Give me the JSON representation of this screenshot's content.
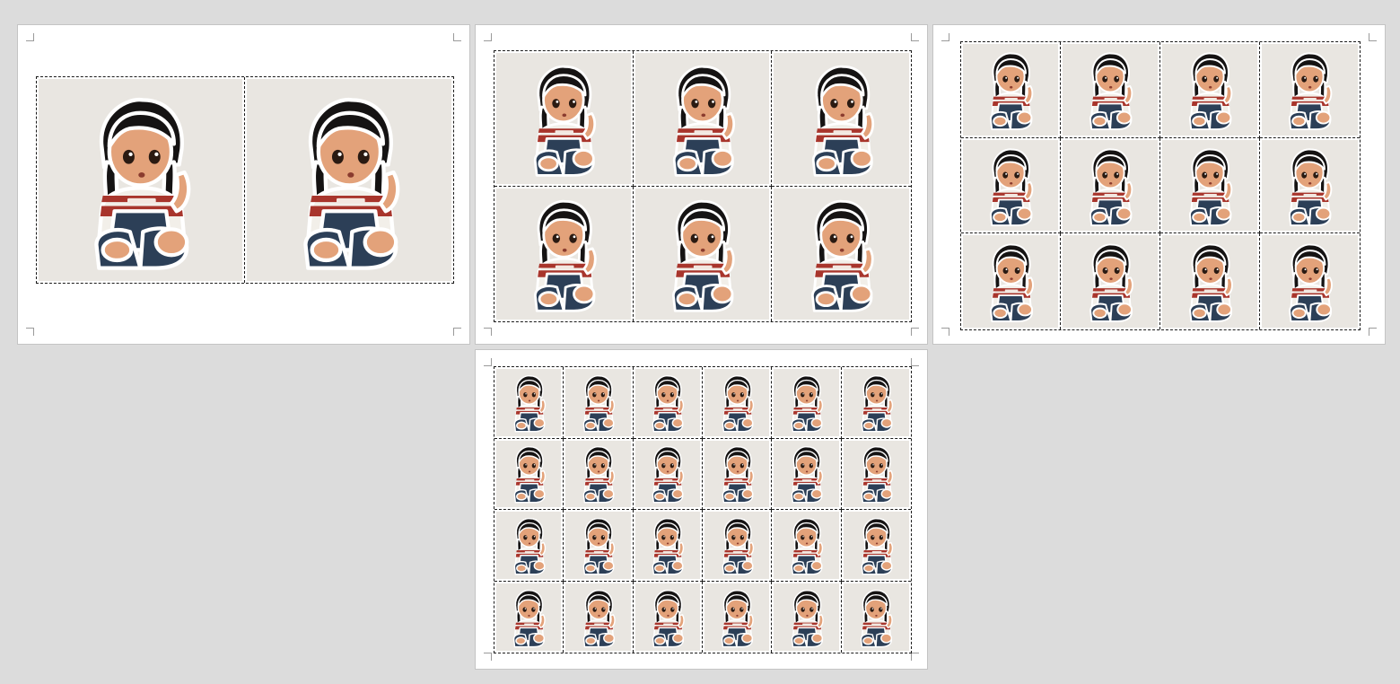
{
  "app": {
    "view": "print-layout-preview"
  },
  "colors": {
    "background": "#dcdcdc",
    "page": "#ffffff",
    "photo_bg": "#e9e6e1",
    "hair": "#151313",
    "skin": "#e3a27a",
    "shirt_red": "#a8352c",
    "shirt_white": "#f2efe9",
    "overalls": "#2c3f57",
    "outline": "#ffffff"
  },
  "sheet_icon": "girl-sticker-illustration",
  "pages": [
    {
      "name": "page-2-up",
      "rows": 1,
      "cols": 2
    },
    {
      "name": "page-6-up",
      "rows": 2,
      "cols": 3
    },
    {
      "name": "page-12-up",
      "rows": 3,
      "cols": 4
    },
    {
      "name": "page-24-up",
      "rows": 4,
      "cols": 6
    }
  ]
}
